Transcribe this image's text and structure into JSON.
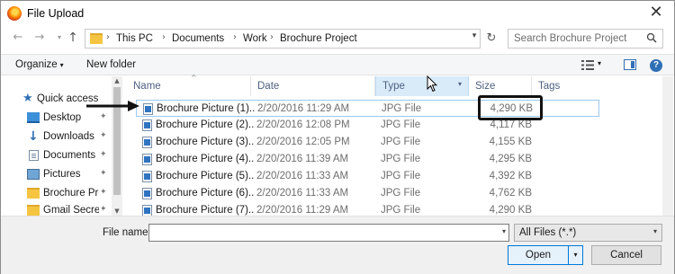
{
  "window": {
    "title": "File Upload",
    "close_glyph": "✕",
    "app_icon": "firefox-icon"
  },
  "nav": {
    "back_glyph": "←",
    "forward_glyph": "→",
    "recent_glyph": "▾",
    "up_glyph": "↑",
    "breadcrumb": [
      "This PC",
      "Documents",
      "Work",
      "Brochure Project"
    ],
    "crumb_sep": "›",
    "refresh_glyph": "↻",
    "search_placeholder": "Search Brochure Project"
  },
  "toolbar": {
    "organize_label": "Organize",
    "organize_caret": "▾",
    "new_folder_label": "New folder",
    "view_caret": "▾",
    "help_glyph": "?"
  },
  "sidebar": {
    "items": [
      {
        "label": "Quick access",
        "icon": "star-icon",
        "pinned": false
      },
      {
        "label": "Desktop",
        "icon": "desktop-icon",
        "pinned": true
      },
      {
        "label": "Downloads",
        "icon": "downloads-icon",
        "pinned": true
      },
      {
        "label": "Documents",
        "icon": "documents-icon",
        "pinned": true
      },
      {
        "label": "Pictures",
        "icon": "pictures-icon",
        "pinned": true
      },
      {
        "label": "Brochure Pro",
        "icon": "folder-icon",
        "pinned": true
      },
      {
        "label": "Gmail Secrets",
        "icon": "folder-icon",
        "pinned": true
      }
    ],
    "pin_glyph": "✦"
  },
  "columns": {
    "name": "Name",
    "date": "Date",
    "type": "Type",
    "size": "Size",
    "tags": "Tags",
    "sort_glyph": "^",
    "type_dd": "▾"
  },
  "files": [
    {
      "name": "Brochure Picture (1)....",
      "date": "2/20/2016 11:29 AM",
      "type": "JPG File",
      "size": "4,290 KB"
    },
    {
      "name": "Brochure Picture (2)....",
      "date": "2/20/2016 12:08 PM",
      "type": "JPG File",
      "size": "4,117 KB"
    },
    {
      "name": "Brochure Picture (3)....",
      "date": "2/20/2016 12:05 PM",
      "type": "JPG File",
      "size": "4,155 KB"
    },
    {
      "name": "Brochure Picture (4)....",
      "date": "2/20/2016 11:39 AM",
      "type": "JPG File",
      "size": "4,295 KB"
    },
    {
      "name": "Brochure Picture (5)....",
      "date": "2/20/2016 11:33 AM",
      "type": "JPG File",
      "size": "4,392 KB"
    },
    {
      "name": "Brochure Picture (6)....",
      "date": "2/20/2016 11:33 AM",
      "type": "JPG File",
      "size": "4,762 KB"
    },
    {
      "name": "Brochure Picture (7)....",
      "date": "2/20/2016 11:29 AM",
      "type": "JPG File",
      "size": "4,290 KB"
    }
  ],
  "bottom": {
    "file_name_label": "File name:",
    "file_name_value": "",
    "filter_value": "All Files (*.*)",
    "dd_glyph": "▾",
    "open_label": "Open",
    "cancel_label": "Cancel"
  }
}
